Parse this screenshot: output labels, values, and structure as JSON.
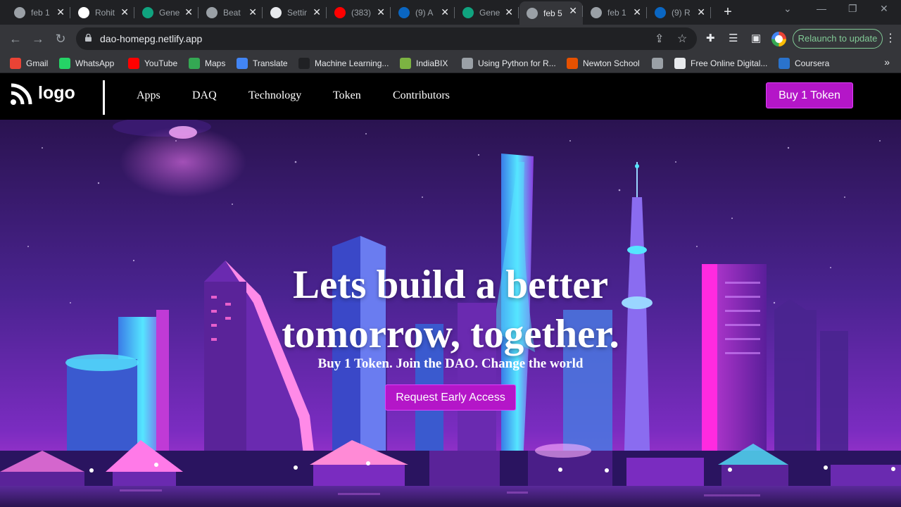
{
  "browser": {
    "tabs": [
      {
        "title": "feb 1",
        "icon": "globe-icon",
        "color": "#9aa0a6"
      },
      {
        "title": "Rohit",
        "icon": "github-icon",
        "color": "#ffffff"
      },
      {
        "title": "Gene",
        "icon": "diamond-icon",
        "color": "#10a37f"
      },
      {
        "title": "Beat",
        "icon": "globe-icon",
        "color": "#9aa0a6"
      },
      {
        "title": "Settir",
        "icon": "wordpress-icon",
        "color": "#e8eaed"
      },
      {
        "title": "(383)",
        "icon": "youtube-icon",
        "color": "#ff0000"
      },
      {
        "title": "(9) A",
        "icon": "linkedin-icon",
        "color": "#0a66c2"
      },
      {
        "title": "Gene",
        "icon": "diamond-icon",
        "color": "#10a37f"
      },
      {
        "title": "feb 5",
        "icon": "globe-icon",
        "color": "#9aa0a6"
      },
      {
        "title": "feb 1",
        "icon": "globe-icon",
        "color": "#9aa0a6"
      },
      {
        "title": "(9) R",
        "icon": "linkedin-icon",
        "color": "#0a66c2"
      }
    ],
    "active_tab_index": 8,
    "url": "dao-homepg.netlify.app",
    "relaunch_label": "Relaunch to update",
    "bookmarks": [
      {
        "label": "Gmail",
        "icon": "gmail-icon",
        "color": "#ea4335"
      },
      {
        "label": "WhatsApp",
        "icon": "whatsapp-icon",
        "color": "#25d366"
      },
      {
        "label": "YouTube",
        "icon": "youtube-icon",
        "color": "#ff0000"
      },
      {
        "label": "Maps",
        "icon": "maps-pin-icon",
        "color": "#34a853"
      },
      {
        "label": "Translate",
        "icon": "translate-icon",
        "color": "#4285f4"
      },
      {
        "label": "Machine Learning...",
        "icon": "ml-icon",
        "color": "#202124"
      },
      {
        "label": "IndiaBIX",
        "icon": "indiabix-icon",
        "color": "#7cb342"
      },
      {
        "label": "Using Python for R...",
        "icon": "globe-icon",
        "color": "#9aa0a6"
      },
      {
        "label": "Newton School",
        "icon": "newton-icon",
        "color": "#e65100"
      },
      {
        "label": "",
        "icon": "globe-icon",
        "color": "#9aa0a6"
      },
      {
        "label": "Free Online Digital...",
        "icon": "doc-icon",
        "color": "#e8eaed"
      },
      {
        "label": "Coursera",
        "icon": "coursera-icon",
        "color": "#2a73cc"
      }
    ]
  },
  "site": {
    "logo_text": "logo",
    "nav": [
      "Apps",
      "DAQ",
      "Technology",
      "Token",
      "Contributors"
    ],
    "buy_button": "Buy 1 Token",
    "headline_line1": "Lets build a better",
    "headline_line2": "tomorrow, together.",
    "subheadline": "Buy 1 Token. Join the DAO. Change the world",
    "cta_button": "Request Early Access",
    "accent_color": "#b416c8"
  }
}
